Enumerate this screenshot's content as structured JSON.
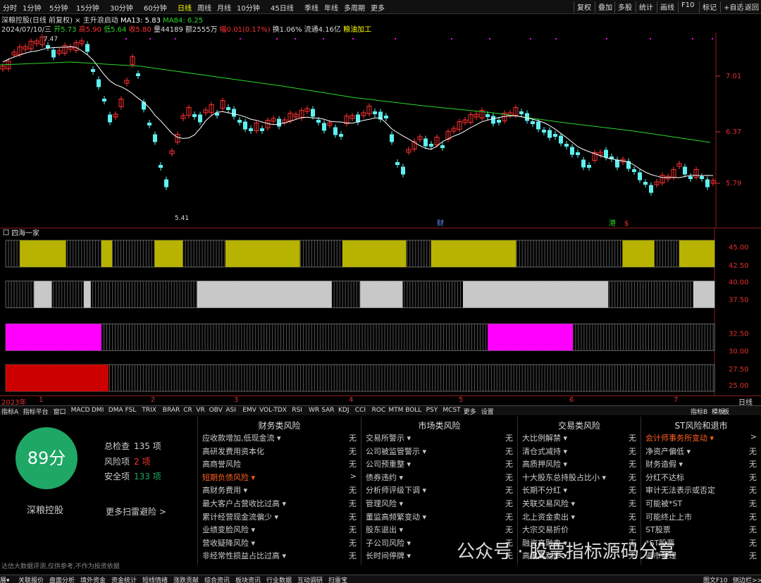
{
  "toolbar": {
    "tabs": [
      "分时",
      "1分钟",
      "5分钟",
      "15分钟",
      "30分钟",
      "60分钟",
      "日线",
      "周线",
      "月线",
      "10分钟",
      "45日线",
      "季线",
      "年线",
      "多周期",
      "更多"
    ],
    "selected_tab": "日线",
    "right_buttons": [
      "复权",
      "叠加",
      "多股",
      "统计",
      "画线",
      "F10",
      "标记",
      "+自选",
      "返回"
    ]
  },
  "stock": {
    "title": "深粮控股(日线 前复权)",
    "indicator_name": "主升浪启动",
    "ma13": "MA13: 5.83",
    "ma84": "MA84: 6.25",
    "date": "2024/07/10/三",
    "open": "开5.73",
    "high": "高5.90",
    "low": "低5.64",
    "close": "收5.80",
    "volume": "量44189",
    "amount": "额2555万",
    "change": "幅0.01(0.17%)",
    "turnover": "换1.06%",
    "float": "流通4.16亿",
    "industry": "粮油加工"
  },
  "main_chart": {
    "price_labels": [
      "7.01",
      "6.37",
      "5.79"
    ],
    "high_mark": "7.47",
    "low_mark": "5.41",
    "event_labels": [
      "财",
      "港",
      "$"
    ],
    "ma_colors": {
      "ma13": "#ffffff",
      "ma84": "#2bd62b"
    },
    "up_color": "#ff3030",
    "down_color": "#5ff0f0"
  },
  "sub_chart": {
    "name": "四海一家",
    "y_labels": [
      "45.00",
      "42.50",
      "40.00",
      "37.50",
      "32.50",
      "30.00",
      "27.50",
      "25.00"
    ],
    "bands": [
      {
        "color": "#b7b300",
        "blocks": [
          [
            0.02,
            0.085
          ],
          [
            0.135,
            0.15
          ],
          [
            0.21,
            0.25
          ],
          [
            0.31,
            0.415
          ],
          [
            0.475,
            0.565
          ],
          [
            0.6,
            0.72
          ],
          [
            0.87,
            0.915
          ],
          [
            0.95,
            1.01
          ]
        ]
      },
      {
        "color": "#c8c8c8",
        "blocks": [
          [
            0.04,
            0.065
          ],
          [
            0.11,
            0.12
          ],
          [
            0.27,
            0.46
          ],
          [
            0.5,
            0.56
          ],
          [
            0.645,
            0.85
          ],
          [
            0.97,
            1.03
          ]
        ]
      },
      {
        "color": "#ff00ff",
        "blocks": [
          [
            0.0,
            0.135
          ],
          [
            0.68,
            0.8
          ]
        ]
      },
      {
        "color": "#cc0000",
        "blocks": [
          [
            0.0,
            0.145
          ]
        ]
      }
    ]
  },
  "x_axis": {
    "year": "2023年",
    "months": [
      "1",
      "2",
      "3",
      "4",
      "5",
      "6",
      "7"
    ],
    "period": "日线"
  },
  "indicator_bar": [
    "指标A",
    "指标平台",
    "窗口",
    "MACD",
    "DMI",
    "DMA",
    "FSL",
    "TRIX",
    "BRAR",
    "CR",
    "VR",
    "OBV",
    "ASI",
    "EMV",
    "VOL-TDX",
    "RSI",
    "WR",
    "SAR",
    "KDJ",
    "CCI",
    "ROC",
    "MTM",
    "BOLL",
    "PSY",
    "MCST",
    "更多",
    "设置"
  ],
  "indicator_bar_right": [
    "指标B",
    "模板",
    "板"
  ],
  "risk": {
    "score": "89分",
    "total_label": "总检查",
    "total_value": "135 项",
    "risk_label": "风险项",
    "risk_value": "2 项",
    "risk_color": "#ff3030",
    "safe_label": "安全项",
    "safe_value": "133 项",
    "safe_color": "#1fa765",
    "stock_name": "深粮控股",
    "more_link": "更多扫雷避险 >",
    "disclaimer": "达信大数据评测,仅供参考,不作为投资依据",
    "columns": [
      {
        "title": "财务类风险",
        "items": [
          {
            "label": "应收款增加,低现金流 ▾",
            "value": "无"
          },
          {
            "label": "高研发费用资本化",
            "value": "无"
          },
          {
            "label": "高商誉风险",
            "value": "无"
          },
          {
            "label": "短期负债风险 ▾",
            "value": ">",
            "warn": true
          },
          {
            "label": "高财务费用 ▾",
            "value": "无"
          },
          {
            "label": "最大客户占营收比过高 ▾",
            "value": "无"
          },
          {
            "label": "累计经营现金流偏少 ▾",
            "value": "无"
          },
          {
            "label": "业绩变脸风险 ▾",
            "value": "无"
          },
          {
            "label": "营收疑降风险 ▾",
            "value": "无"
          },
          {
            "label": "非经常性损益占比过高 ▾",
            "value": "无"
          }
        ]
      },
      {
        "title": "市场类风险",
        "items": [
          {
            "label": "交易所警示 ▾",
            "value": "无"
          },
          {
            "label": "公司被监管警示 ▾",
            "value": "无"
          },
          {
            "label": "公司预重整 ▾",
            "value": "无"
          },
          {
            "label": "债券违约 ▾",
            "value": "无"
          },
          {
            "label": "分析师评级下调 ▾",
            "value": "无"
          },
          {
            "label": "管理风险 ▾",
            "value": "无"
          },
          {
            "label": "董监高频繁变动 ▾",
            "value": "无"
          },
          {
            "label": "股东退出 ▾",
            "value": "无"
          },
          {
            "label": "子公司风险 ▾",
            "value": "无"
          },
          {
            "label": "长时间停牌 ▾",
            "value": "无"
          }
        ]
      },
      {
        "title": "交易类风险",
        "items": [
          {
            "label": "大比例解禁 ▾",
            "value": "无"
          },
          {
            "label": "清仓式减持 ▾",
            "value": "无"
          },
          {
            "label": "高质押风险 ▾",
            "value": "无"
          },
          {
            "label": "十大股东总持股占比小 ▾",
            "value": "无"
          },
          {
            "label": "长期不分红 ▾",
            "value": "无"
          },
          {
            "label": "关联交易风险 ▾",
            "value": "无"
          },
          {
            "label": "北上资金卖出 ▾",
            "value": "无"
          },
          {
            "label": "大宗交易折价",
            "value": "无"
          },
          {
            "label": "融资高融卖 ▾",
            "value": "无"
          },
          {
            "label": "高偏离利率 ▾",
            "value": "无"
          }
        ]
      },
      {
        "title": "ST风险和退市",
        "items": [
          {
            "label": "会计师事务所变动 ▾",
            "value": ">",
            "warn": true
          },
          {
            "label": "净资产偏低 ▾",
            "value": "无"
          },
          {
            "label": "财务造假 ▾",
            "value": "无"
          },
          {
            "label": "分红不达标",
            "value": "无"
          },
          {
            "label": "审计无法表示或否定",
            "value": "无"
          },
          {
            "label": "可能被*ST",
            "value": "无"
          },
          {
            "label": "可能终止上市",
            "value": "无"
          },
          {
            "label": "ST股票",
            "value": "无"
          },
          {
            "label": "*ST股票",
            "value": "无"
          },
          {
            "label": "退市整理",
            "value": "无"
          }
        ]
      }
    ]
  },
  "statusbar": [
    "展▾",
    "关联报价",
    "盘面分析",
    "境外资金",
    "资金统计",
    "短线情绪",
    "涨跌贡献",
    "综合资讯",
    "板块资讯",
    "行业数据",
    "互动调研",
    "扫雷宝"
  ],
  "statusbar_right": [
    "图文F10",
    "侧边栏>>"
  ],
  "watermark": "公众号 · 股票指标源码分享"
}
